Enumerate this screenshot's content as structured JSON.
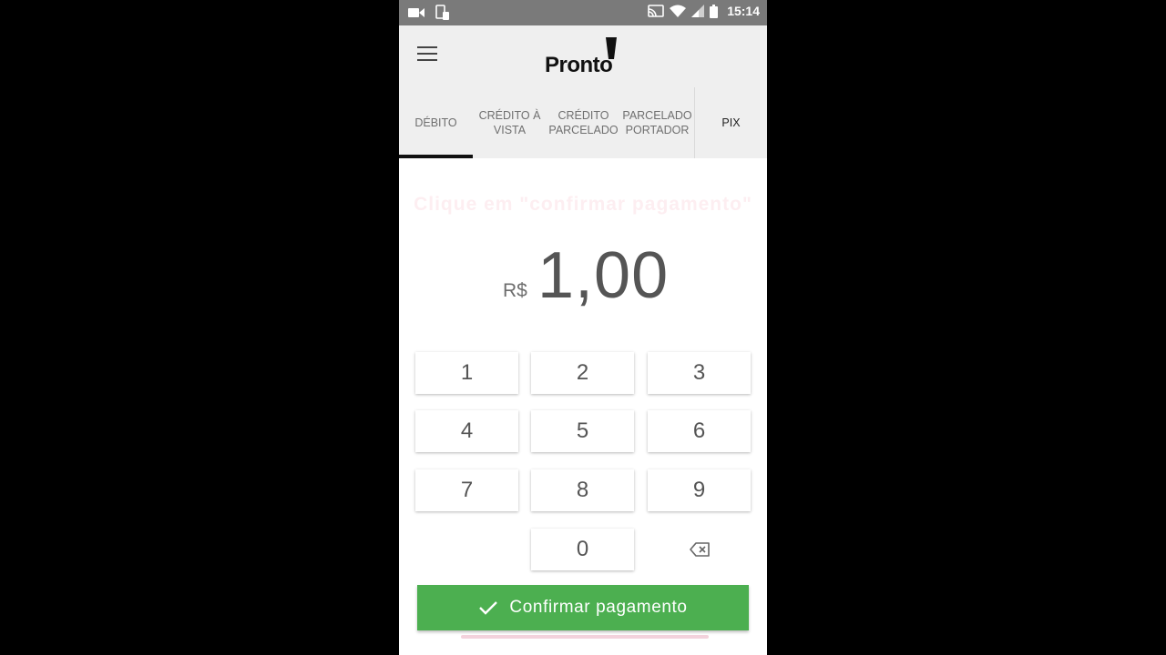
{
  "status_bar": {
    "time": "15:14"
  },
  "header": {
    "logo_text": "Pronto"
  },
  "tabs": [
    {
      "label": "DÉBITO",
      "active": true
    },
    {
      "label": "CRÉDITO À VISTA"
    },
    {
      "label": "CRÉDITO PARCELADO"
    },
    {
      "label": "PARCELADO PORTADOR"
    },
    {
      "label": "PIX"
    }
  ],
  "hint": "Clique em \"confirmar pagamento\"",
  "amount": {
    "currency": "R$",
    "value": "1,00"
  },
  "keypad": {
    "k1": "1",
    "k2": "2",
    "k3": "3",
    "k4": "4",
    "k5": "5",
    "k6": "6",
    "k7": "7",
    "k8": "8",
    "k9": "9",
    "k0": "0"
  },
  "confirm_label": "Confirmar pagamento",
  "colors": {
    "accent": "#4caf50",
    "status_bar": "#7a7a7a",
    "header": "#efefef"
  }
}
